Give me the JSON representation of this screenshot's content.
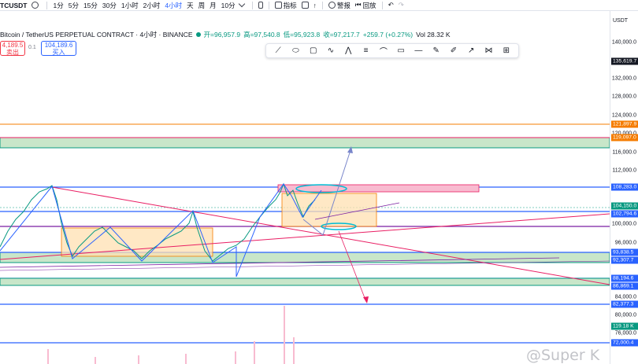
{
  "toolbar": {
    "symbol": "TCUSDT",
    "timeframes": [
      "1分",
      "5分",
      "15分",
      "30分",
      "1小时",
      "2小时",
      "4小时",
      "天",
      "周",
      "月",
      "10分"
    ],
    "active_timeframe": "4小时",
    "indicators_label": "指标",
    "alert_label": "警报",
    "replay_label": "回放"
  },
  "legend": {
    "title": "Bitcoin / TetherUS PERPETUAL CONTRACT · 4小时 · BINANCE",
    "open": "开=96,957.9",
    "high": "高=97,540.8",
    "low": "低=95,923.8",
    "close": "收=97,217.7",
    "change": "+259.7 (+0.27%)",
    "volume": "Vol 28.32 K"
  },
  "trade": {
    "sell_price": "4,189.5",
    "sell_label": "卖出",
    "spread": "0.1",
    "buy_price": "104,189.6",
    "buy_label": "买入"
  },
  "axis": {
    "currency": "USDT",
    "ticks": [
      "140,000.0",
      "132,000.0",
      "128,000.0",
      "124,000.0",
      "120,000.0",
      "116,000.0",
      "112,000.0",
      "100,000.0",
      "96,000.0",
      "84,000.0",
      "80,000.0",
      "76,000.0"
    ],
    "tags": [
      {
        "text": "135,619.7",
        "color": "#131722"
      },
      {
        "text": "121,897.9",
        "color": "#f57c00"
      },
      {
        "text": "119,097.0",
        "color": "#f57c00"
      },
      {
        "text": "108,283.0",
        "color": "#2962ff"
      },
      {
        "text": "104,150.0",
        "color": "#089981"
      },
      {
        "text": "102,794.6",
        "color": "#2962ff"
      },
      {
        "text": "93,838.5",
        "color": "#2962ff"
      },
      {
        "text": "92,307.7",
        "color": "#2962ff"
      },
      {
        "text": "88,194.6",
        "color": "#2962ff"
      },
      {
        "text": "86,869.1",
        "color": "#2962ff"
      },
      {
        "text": "82,377.3",
        "color": "#2962ff"
      },
      {
        "text": "119.18 K",
        "color": "#089981"
      },
      {
        "text": "72,000.4",
        "color": "#2962ff"
      }
    ]
  },
  "drawing_tools": [
    "line-tool-icon",
    "shape-tool-icon",
    "rectangle-tool-icon",
    "path-tool-icon",
    "pattern-tool-icon",
    "fib-tool-icon",
    "curve-tool-icon",
    "callout-tool-icon",
    "hline-tool-icon",
    "brush-tool-icon",
    "pen-tool-icon",
    "ray-tool-icon",
    "node-tool-icon",
    "measure-tool-icon"
  ],
  "watermark": "@Super K"
}
